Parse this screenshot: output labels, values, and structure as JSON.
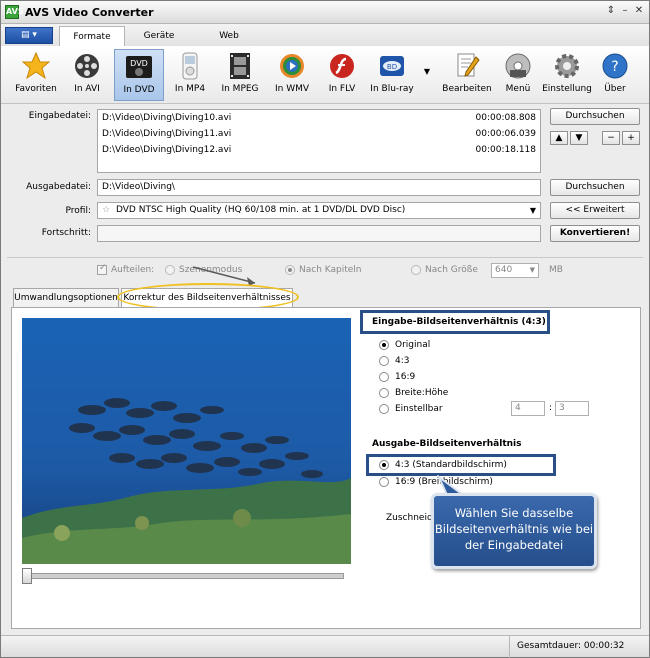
{
  "window": {
    "title": "AVS Video Converter",
    "app_icon_text": "AVS"
  },
  "ribbon": {
    "tabs": [
      "Formate",
      "Geräte",
      "Web"
    ]
  },
  "toolbar": {
    "items": [
      {
        "label": "Favoriten",
        "icon": "star-icon"
      },
      {
        "label": "In AVI",
        "icon": "film-reel-icon"
      },
      {
        "label": "In DVD",
        "icon": "dvd-icon"
      },
      {
        "label": "In MP4",
        "icon": "ipod-icon"
      },
      {
        "label": "In MPEG",
        "icon": "film-strip-icon"
      },
      {
        "label": "In WMV",
        "icon": "wmv-icon"
      },
      {
        "label": "In FLV",
        "icon": "flash-icon"
      },
      {
        "label": "In Blu-ray",
        "icon": "bluray-icon"
      },
      {
        "label": "Bearbeiten",
        "icon": "edit-icon"
      },
      {
        "label": "Menü",
        "icon": "menu-disc-icon"
      },
      {
        "label": "Einstellung",
        "icon": "gear-icon"
      },
      {
        "label": "Über",
        "icon": "help-icon"
      }
    ],
    "dvd_icon_text": "DVD"
  },
  "form": {
    "input_label": "Eingabedatei:",
    "input_files": [
      {
        "path": "D:\\Video\\Diving\\Diving10.avi",
        "duration": "00:00:08.808"
      },
      {
        "path": "D:\\Video\\Diving\\Diving11.avi",
        "duration": "00:00:06.039"
      },
      {
        "path": "D:\\Video\\Diving\\Diving12.avi",
        "duration": "00:00:18.118"
      }
    ],
    "browse_label": "Durchsuchen",
    "output_label": "Ausgabedatei:",
    "output_value": "D:\\Video\\Diving\\",
    "output_browse_label": "Durchsuchen",
    "profile_label": "Profil:",
    "profile_value": "DVD NTSC High Quality (HQ 60/108 min. at 1 DVD/DL DVD Disc)",
    "advanced_label": "<< Erweitert",
    "progress_label": "Fortschritt:",
    "convert_label": "Konvertieren!"
  },
  "split_options": {
    "split_label": "Aufteilen:",
    "modes": [
      "Szenenmodus",
      "Nach Kapiteln",
      "Nach Größe"
    ],
    "size_value": "640",
    "size_unit": "MB"
  },
  "panel_tabs": [
    "Umwandlungsoptionen",
    "Korrektur des Bildseitenverhältnisses"
  ],
  "aspect": {
    "input_title": "Eingabe-Bildseitenverhältnis (4:3)",
    "input_options": [
      "Original",
      "4:3",
      "16:9",
      "Breite:Höhe",
      "Einstellbar"
    ],
    "input_selected": 0,
    "custom_w": "4",
    "custom_h": "3",
    "output_title": "Ausgabe-Bildseitenverhältnis",
    "output_options": [
      "4:3 (Standardbildschirm)",
      "16:9 (Breitbildschirm)"
    ],
    "output_selected": 0,
    "crop_label": "Zuschneiden"
  },
  "callout": {
    "text": "Wählen Sie dasselbe Bildseitenverhältnis wie bei der Eingabedatei"
  },
  "status": {
    "total_duration": "Gesamtdauer: 00:00:32"
  },
  "colors": {
    "callout_bg": "#2f5c9c",
    "highlight_border": "#2a4f86",
    "tab_highlight": "#f0c020"
  }
}
